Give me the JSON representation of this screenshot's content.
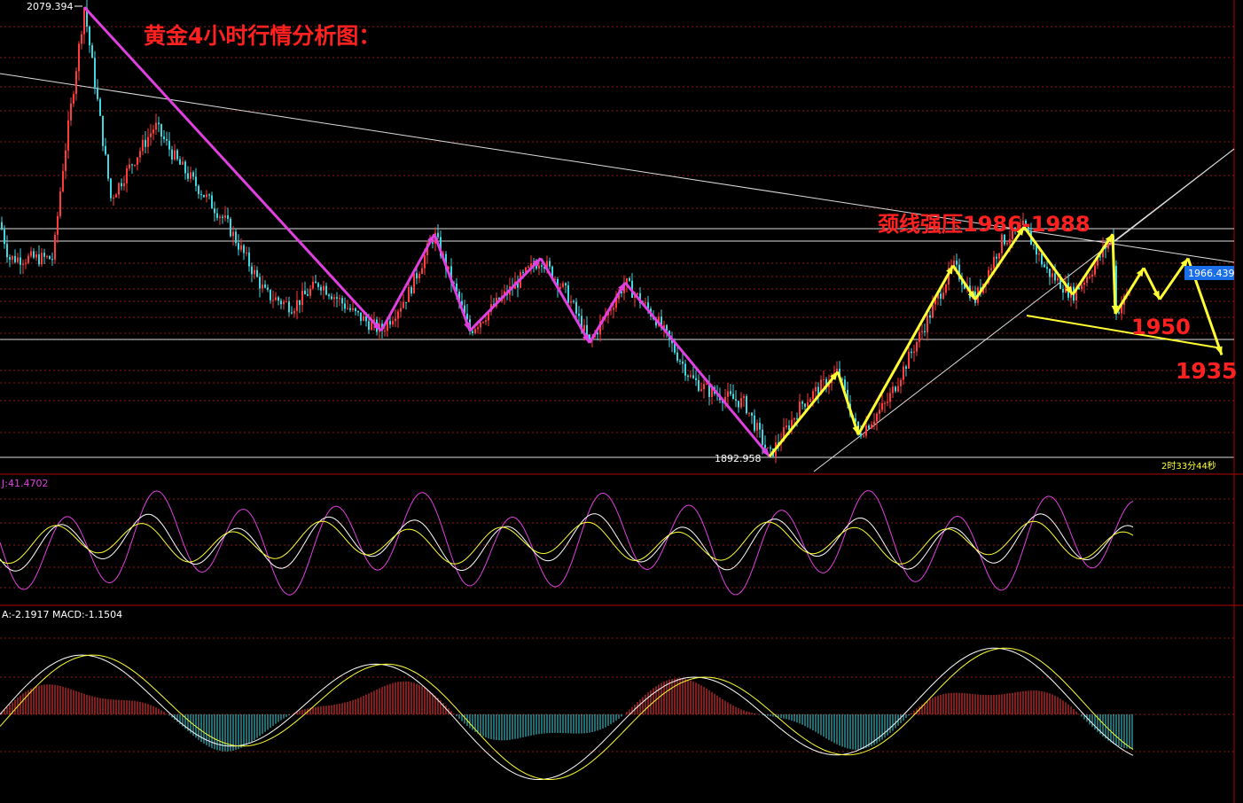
{
  "title": "黄金4小时行情分析图：",
  "annotations": {
    "neckline": "颈线强压1986-1988",
    "target1": "1950",
    "target2": "1935",
    "high_label": "2079.394",
    "low_label": "1892.958",
    "current_price": "1966.439",
    "countdown": "2时33分44秒"
  },
  "kdj": {
    "label": "J:41.4702"
  },
  "macd": {
    "label": "A:-2.1917  MACD:-1.1504"
  },
  "colors": {
    "bull": "#ff3b3b",
    "bear": "#3fd7e0",
    "magenta": "#e040e0",
    "yellow": "#ffff33",
    "title_red": "#ff2020",
    "price_tag": "#1a6ee8"
  },
  "chart_data": [
    {
      "type": "candlestick",
      "panel": "price",
      "y_markers": {
        "high": 2079.394,
        "low": 1892.958,
        "current": 1966.439
      },
      "neckline_resistance": [
        1986,
        1988
      ],
      "targets": [
        1950,
        1935
      ],
      "magenta_waves": [
        {
          "index": 95,
          "price": 2079
        },
        {
          "index": 430,
          "price": 1945
        },
        {
          "index": 490,
          "price": 1985
        },
        {
          "index": 530,
          "price": 1945
        },
        {
          "index": 610,
          "price": 1975
        },
        {
          "index": 665,
          "price": 1940
        },
        {
          "index": 705,
          "price": 1965
        },
        {
          "index": 868,
          "price": 1893
        }
      ],
      "yellow_waves": [
        {
          "index": 868,
          "price": 1893
        },
        {
          "index": 945,
          "price": 1928
        },
        {
          "index": 968,
          "price": 1902
        },
        {
          "index": 1075,
          "price": 1972
        },
        {
          "index": 1100,
          "price": 1958
        },
        {
          "index": 1155,
          "price": 1988
        },
        {
          "index": 1210,
          "price": 1960
        },
        {
          "index": 1255,
          "price": 1985
        },
        {
          "index": 1258,
          "price": 1952
        },
        {
          "index": 1290,
          "price": 1971
        },
        {
          "index": 1308,
          "price": 1958
        },
        {
          "index": 1340,
          "price": 1975
        },
        {
          "index": 1378,
          "price": 1935
        }
      ]
    },
    {
      "type": "line",
      "panel": "kdj",
      "series": [
        {
          "name": "J",
          "last": 41.4702
        }
      ]
    },
    {
      "type": "bar",
      "panel": "macd",
      "series": [
        {
          "name": "MACD",
          "last": -1.1504
        },
        {
          "name": "A",
          "last": -2.1917
        }
      ]
    }
  ]
}
